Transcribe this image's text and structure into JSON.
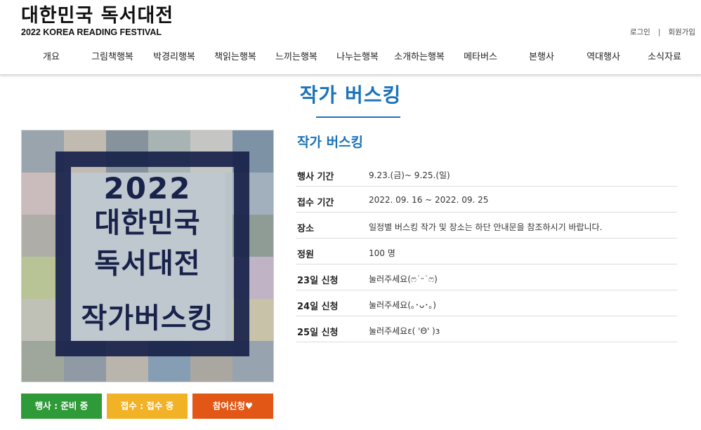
{
  "logo": {
    "korean": "대한민국 독서대전",
    "english": "2022 KOREA READING FESTIVAL"
  },
  "util": {
    "login": "로그인",
    "separator": "|",
    "signup": "회원가입"
  },
  "nav": [
    "개요",
    "그림책행복",
    "박경리행복",
    "책읽는행복",
    "느끼는행복",
    "나누는행복",
    "소개하는행복",
    "메타버스",
    "본행사",
    "역대행사",
    "소식자료"
  ],
  "page_title": "작가 버스킹",
  "poster": {
    "year": "2022",
    "line1": "대한민국",
    "line2": "독서대전",
    "line3": "작가버스킹"
  },
  "info": {
    "title": "작가 버스킹",
    "rows": [
      {
        "label": "행사 기간",
        "value": "9.23.(금)~ 9.25.(일)"
      },
      {
        "label": "접수 기간",
        "value": "2022. 09. 16 ~ 2022. 09. 25"
      },
      {
        "label": "장소",
        "value": "일정별 버스킹 작가 및 장소는 하단 안내문을 참조하시기 바랍니다."
      },
      {
        "label": "정원",
        "value": "100 명"
      },
      {
        "label": "23일 신청",
        "value": "눌러주세요(ෆ˙ᵕ˙ෆ)"
      },
      {
        "label": "24일 신청",
        "value": "눌러주세요(｡･ᴗ･｡)"
      },
      {
        "label": "25일 신청",
        "value": "눌러주세요ε( 'Θ' )з"
      }
    ]
  },
  "buttons": {
    "event_status": "행사 : 준비 중",
    "reception_status": "접수 : 접수 중",
    "apply": "참여신청♥"
  },
  "colors": {
    "accent": "#1b73b8",
    "green": "#2f9a38",
    "yellow": "#f2b225",
    "red": "#e25716",
    "poster_navy": "#18224a"
  }
}
